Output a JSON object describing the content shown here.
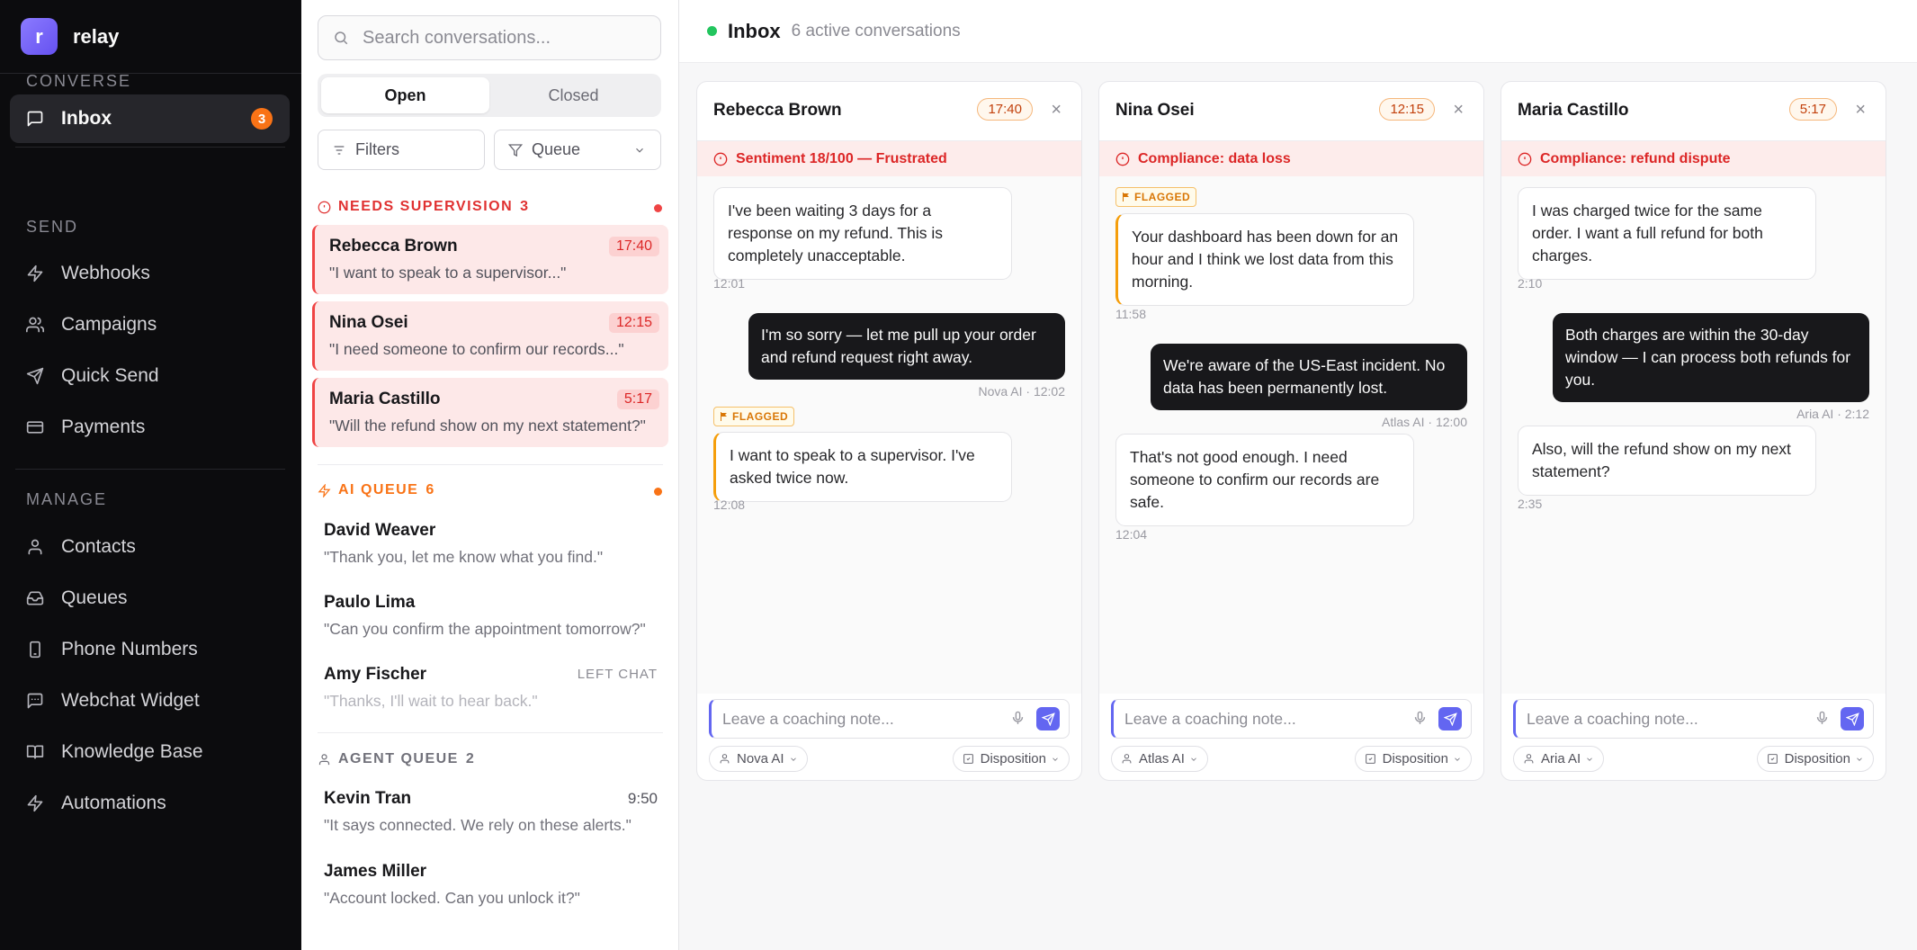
{
  "app": {
    "logo_letter": "r",
    "name": "relay"
  },
  "sidebar": {
    "sections": [
      {
        "label": "CONVERSE"
      },
      {
        "label": "SEND"
      },
      {
        "label": "MANAGE"
      }
    ],
    "items": [
      {
        "label": "Inbox",
        "icon": "message-square-icon",
        "badge": "3",
        "active": true
      },
      {
        "label": "Webhooks",
        "icon": "bolt-icon"
      },
      {
        "label": "Campaigns",
        "icon": "users-icon"
      },
      {
        "label": "Quick Send",
        "icon": "paper-plane-icon"
      },
      {
        "label": "Payments",
        "icon": "credit-card-icon"
      },
      {
        "label": "Contacts",
        "icon": "user-icon"
      },
      {
        "label": "Queues",
        "icon": "inbox-tray-icon"
      },
      {
        "label": "Phone Numbers",
        "icon": "phone-icon"
      },
      {
        "label": "Webchat Widget",
        "icon": "chat-widget-icon"
      },
      {
        "label": "Knowledge Base",
        "icon": "book-icon"
      },
      {
        "label": "Automations",
        "icon": "bolt-icon"
      }
    ]
  },
  "list": {
    "search_placeholder": "Search conversations...",
    "tabs": [
      {
        "label": "Open",
        "active": true
      },
      {
        "label": "Closed"
      }
    ],
    "filters_label": "Filters",
    "queue_label": "Queue",
    "groups": {
      "supervision": {
        "label": "NEEDS SUPERVISION",
        "count": "3",
        "color": "#e03131"
      },
      "ai": {
        "label": "AI QUEUE",
        "count": "6",
        "color": "#f97316"
      },
      "agent": {
        "label": "AGENT QUEUE",
        "count": "2",
        "color": "#71717a"
      }
    },
    "supervision": [
      {
        "name": "Rebecca Brown",
        "preview": "\"I want to speak to a supervisor...\"",
        "time": "17:40"
      },
      {
        "name": "Nina Osei",
        "preview": "\"I need someone to confirm our records...\"",
        "time": "12:15"
      },
      {
        "name": "Maria Castillo",
        "preview": "\"Will the refund show on my next statement?\"",
        "time": "5:17"
      }
    ],
    "ai": [
      {
        "name": "David Weaver",
        "preview": "\"Thank you, let me know what you find.\""
      },
      {
        "name": "Paulo Lima",
        "preview": "\"Can you confirm the appointment tomorrow?\""
      },
      {
        "name": "Amy Fischer",
        "preview": "\"Thanks, I'll wait to hear back.\"",
        "status": "LEFT CHAT"
      }
    ],
    "agent": [
      {
        "name": "Kevin Tran",
        "preview": "\"It says connected. We rely on these alerts.\"",
        "time": "9:50"
      },
      {
        "name": "James Miller",
        "preview": "\"Account locked. Can you unlock it?\""
      }
    ]
  },
  "topbar": {
    "title": "Inbox",
    "subtitle": "6 active conversations",
    "status_color": "#22c55e"
  },
  "cards": [
    {
      "name": "Rebecca Brown",
      "timer": "17:40",
      "alert": "Sentiment 18/100 — Frustrated",
      "messages": [
        {
          "text": "I've been waiting 3 days for a response on my refund. This is completely unacceptable.",
          "meta": "12:01"
        },
        {
          "text": "I'm so sorry — let me pull up your order and refund request right away.",
          "meta": "Nova AI · 12:02"
        },
        {
          "tag": "FLAGGED",
          "text": "I want to speak to a supervisor. I've asked twice now.",
          "meta": "12:08"
        }
      ],
      "coach_placeholder": "Leave a coaching note...",
      "agent": "Nova AI",
      "disposition": "Disposition"
    },
    {
      "name": "Nina Osei",
      "timer": "12:15",
      "alert": "Compliance: data loss",
      "messages": [
        {
          "tag": "FLAGGED",
          "text": "Your dashboard has been down for an hour and I think we lost data from this morning.",
          "meta": "11:58"
        },
        {
          "text": "We're aware of the US-East incident. No data has been permanently lost.",
          "meta": "Atlas AI · 12:00"
        },
        {
          "text": "That's not good enough. I need someone to confirm our records are safe.",
          "meta": "12:04"
        }
      ],
      "coach_placeholder": "Leave a coaching note...",
      "agent": "Atlas AI",
      "disposition": "Disposition"
    },
    {
      "name": "Maria Castillo",
      "timer": "5:17",
      "alert": "Compliance: refund dispute",
      "messages": [
        {
          "text": "I was charged twice for the same order. I want a full refund for both charges.",
          "meta": "2:10"
        },
        {
          "text": "Both charges are within the 30-day window — I can process both refunds for you.",
          "meta": "Aria AI · 2:12"
        },
        {
          "text": "Also, will the refund show on my next statement?",
          "meta": "2:35"
        }
      ],
      "coach_placeholder": "Leave a coaching note...",
      "agent": "Aria AI",
      "disposition": "Disposition"
    }
  ]
}
